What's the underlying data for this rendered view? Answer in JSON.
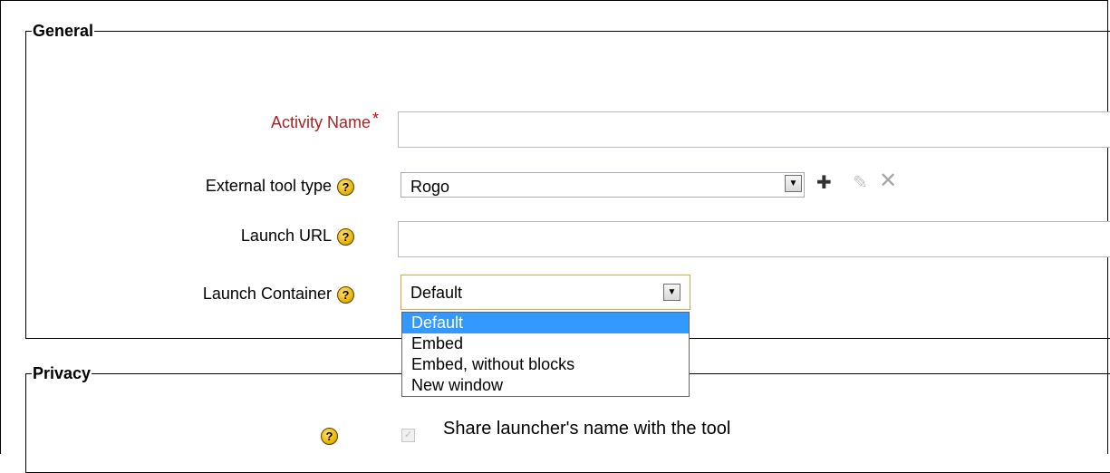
{
  "general": {
    "legend": "General",
    "activity_name": {
      "label": "Activity Name",
      "required_mark": "*",
      "value": ""
    },
    "tool_type": {
      "label": "External tool type",
      "help_icon": "help-icon",
      "value": "Rogo",
      "actions": [
        "add-icon",
        "edit-icon",
        "delete-icon"
      ]
    },
    "launch_url": {
      "label": "Launch URL",
      "help_icon": "help-icon",
      "value": ""
    },
    "launch_container": {
      "label": "Launch Container",
      "help_icon": "help-icon",
      "value": "Default",
      "options": [
        "Default",
        "Embed",
        "Embed, without blocks",
        "New window"
      ],
      "highlighted_index": 0
    }
  },
  "privacy": {
    "legend": "Privacy",
    "share_name": {
      "label": "Share launcher's name with the tool",
      "checked": true,
      "disabled": true
    }
  },
  "colors": {
    "required": "#aa2222",
    "highlight": "#3399ff"
  }
}
